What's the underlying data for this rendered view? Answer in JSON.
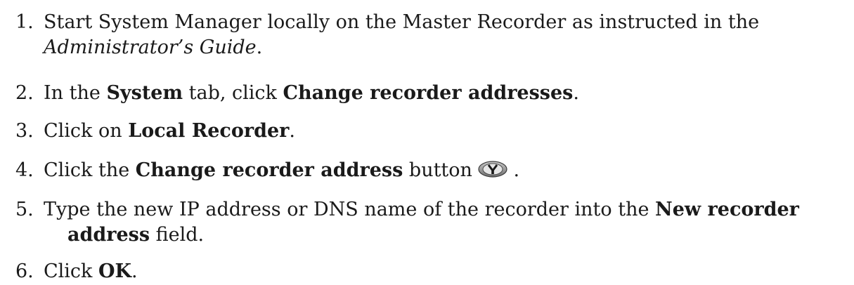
{
  "steps": [
    {
      "number": "1.",
      "line1": "Start System Manager locally on the Master Recorder as instructed in the",
      "line2_italic": "Administrator’s Guide",
      "line2_tail": "."
    },
    {
      "number": "2.",
      "pre": "In the ",
      "bold1": "System",
      "mid": " tab, click ",
      "bold2": "Change recorder addresses",
      "post": "."
    },
    {
      "number": "3.",
      "pre": "Click on ",
      "bold1": "Local Recorder",
      "post": "."
    },
    {
      "number": "4.",
      "pre": "Click the ",
      "bold1": "Change recorder address",
      "mid": " button",
      "post": " .",
      "icon": "change-recorder-address-icon"
    },
    {
      "number": "5.",
      "pre": "Type the new IP address or DNS name of the recorder into the ",
      "bold1": "New recorder",
      "line2_bold": "address",
      "line2_tail": " field."
    },
    {
      "number": "6.",
      "pre": "Click ",
      "bold1": "OK",
      "post": "."
    }
  ]
}
